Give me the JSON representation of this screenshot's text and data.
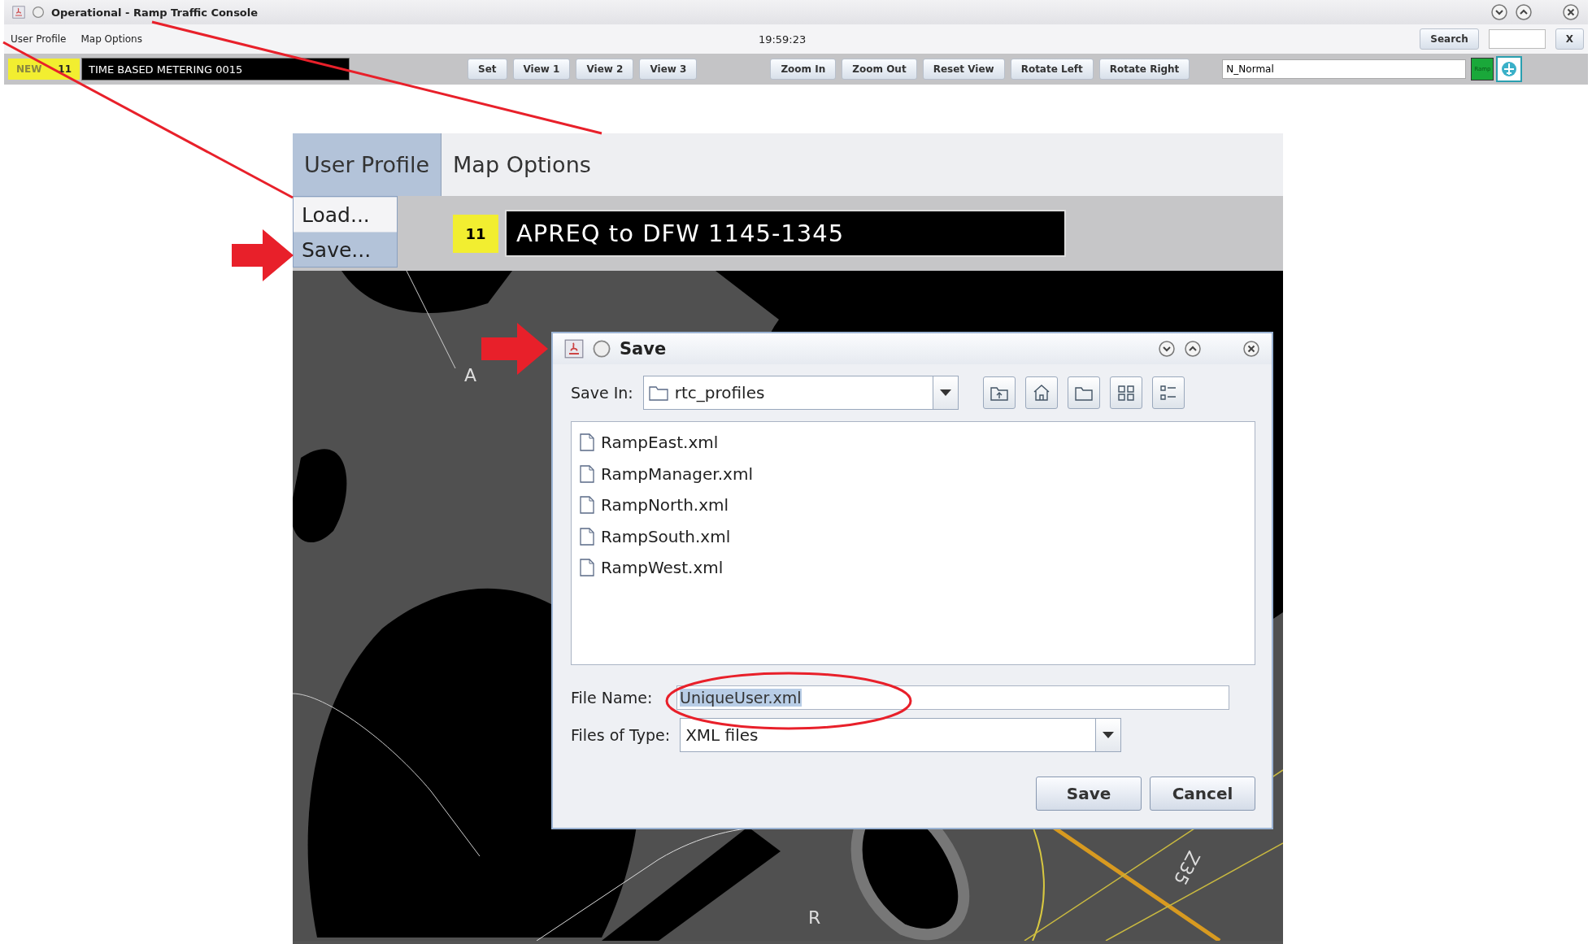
{
  "window": {
    "title": "Operational - Ramp Traffic Console"
  },
  "menu_bar": {
    "menus": [
      {
        "label": "User Profile",
        "selected": false
      },
      {
        "label": "Map Options",
        "selected": false
      }
    ],
    "clock": "19:59:23",
    "search_button": "Search",
    "clear_button": "X"
  },
  "toolbar": {
    "status": "NEW",
    "count": "11",
    "message": "TIME BASED METERING 0015",
    "view_buttons": [
      "Set",
      "View 1",
      "View 2",
      "View 3"
    ],
    "map_buttons": [
      "Zoom In",
      "Zoom Out",
      "Reset View",
      "Rotate Left",
      "Rotate Right"
    ],
    "mode_field": "N_Normal",
    "ramp_badge": "Ramp"
  },
  "inset": {
    "menus": [
      {
        "label": "User Profile",
        "selected": true
      },
      {
        "label": "Map Options",
        "selected": false
      }
    ],
    "menu_items": [
      {
        "label": "Load...",
        "selected": false
      },
      {
        "label": "Save...",
        "selected": true
      }
    ],
    "count": "11",
    "message": "APREQ to DFW 1145-1345",
    "map_labels": [
      "A",
      "R",
      "Z35"
    ]
  },
  "dialog": {
    "title": "Save",
    "save_in_label": "Save In:",
    "save_in": "rtc_profiles",
    "files": [
      "RampEast.xml",
      "RampManager.xml",
      "RampNorth.xml",
      "RampSouth.xml",
      "RampWest.xml"
    ],
    "file_name_label": "File Name:",
    "file_name": "UniqueUser.xml",
    "file_name_selected": true,
    "file_type_label": "Files of Type:",
    "file_type": "XML files",
    "buttons": [
      "Save",
      "Cancel"
    ]
  }
}
